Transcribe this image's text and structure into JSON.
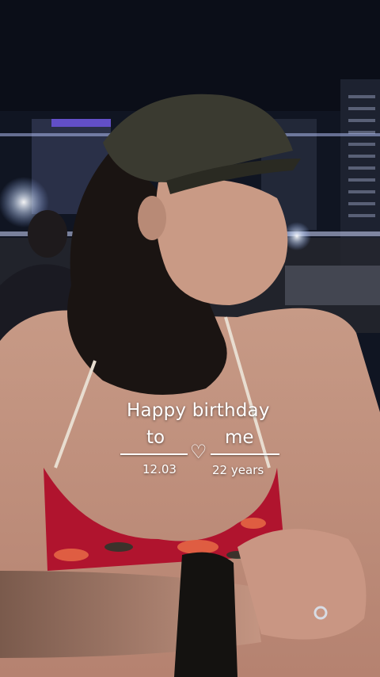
{
  "overlay": {
    "title": "Happy birthday",
    "to": "to",
    "me": "me",
    "heart": "♡",
    "date": "12.03",
    "age": "22 years"
  },
  "colors": {
    "text": "#ffffff",
    "swimsuit_red": "#b0142e",
    "sky": "#0c0f1a"
  }
}
